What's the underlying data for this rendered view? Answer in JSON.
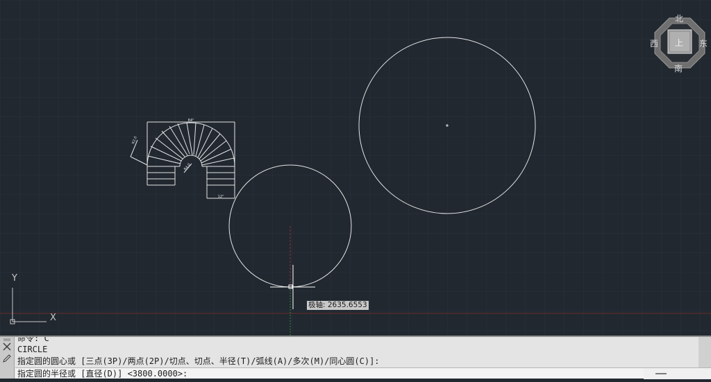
{
  "viewcube": {
    "north": "北",
    "south": "南",
    "east": "东",
    "west": "西",
    "top": "上"
  },
  "ucs": {
    "x_label": "X",
    "y_label": "Y"
  },
  "drawing": {
    "stair_top_dim": "84\"",
    "stair_bottom_dim": "12\"",
    "stair_side_dim": "R2.0",
    "stair_inner_dim": "R4.0"
  },
  "tooltip": {
    "text": "极轴: 2635.6553"
  },
  "command_line": {
    "history": [
      "命令: C",
      "CIRCLE",
      "指定圆的圆心或 [三点(3P)/两点(2P)/切点、切点、半径(T)/弧线(A)/多次(M)/同心圆(C)]:"
    ],
    "prompt": "指定圆的半径或 [直径(D)] <3800.0000>:"
  },
  "icons": {
    "close": "close-icon",
    "customize": "pencil-icon",
    "options": "minimize-icon"
  },
  "colors": {
    "background": "#212830",
    "grid": "#2b333d",
    "geometry": "#e6e6e6",
    "polar_axis": "#6b2f2a",
    "tracking_green": "#2e8b3a"
  }
}
